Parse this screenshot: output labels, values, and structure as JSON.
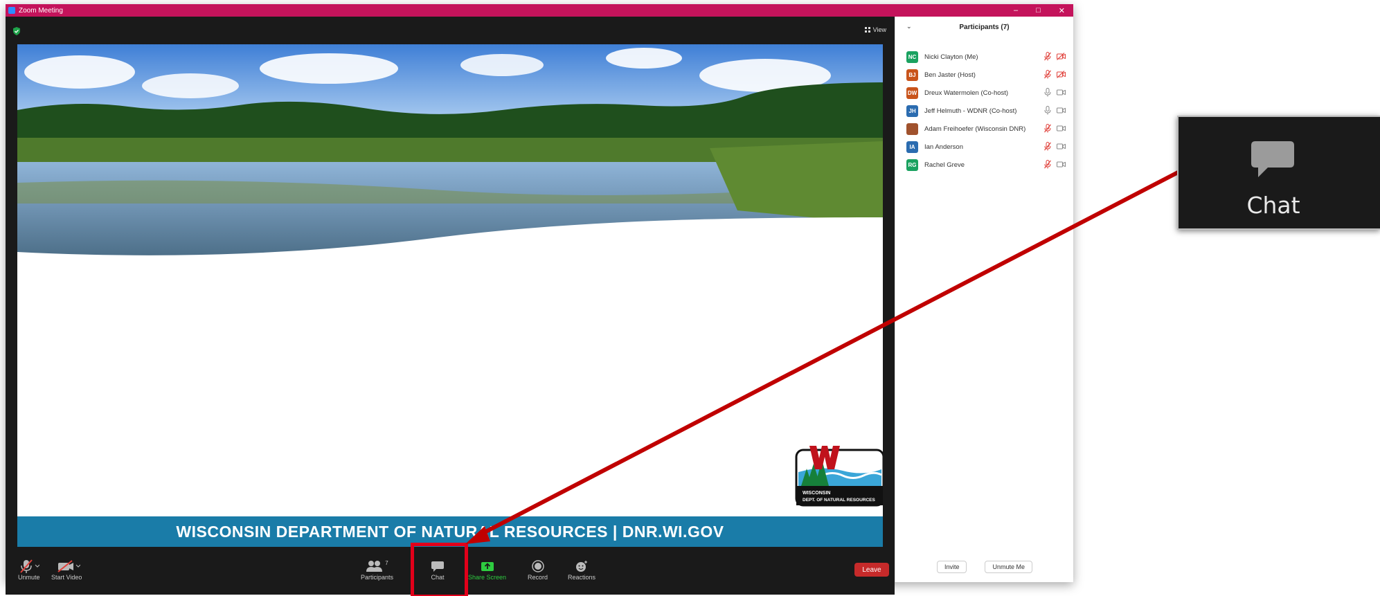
{
  "window": {
    "title": "Zoom Meeting",
    "controls": [
      "–",
      "□",
      "✕"
    ]
  },
  "meeting": {
    "view_label": "View"
  },
  "slide": {
    "banner": "WISCONSIN DEPARTMENT OF NATURAL RESOURCES | DNR.WI.GOV",
    "logo_line1": "WISCONSIN",
    "logo_line2": "DEPT. OF NATURAL RESOURCES"
  },
  "toolbar": {
    "unmute": "Unmute",
    "start_video": "Start Video",
    "participants": "Participants",
    "participants_count": "7",
    "chat": "Chat",
    "share_screen": "Share Screen",
    "record": "Record",
    "reactions": "Reactions",
    "leave": "Leave"
  },
  "panel": {
    "title": "Participants (7)",
    "participants": [
      {
        "initials": "NC",
        "name": "Nicki Clayton (Me)",
        "color": "#1aa260",
        "muted": true,
        "video_off": true
      },
      {
        "initials": "BJ",
        "name": "Ben Jaster (Host)",
        "color": "#c9541b",
        "muted": true,
        "video_off": true
      },
      {
        "initials": "DW",
        "name": "Dreux Watermolen (Co-host)",
        "color": "#c9541b",
        "muted": false,
        "video_off": false
      },
      {
        "initials": "JH",
        "name": "Jeff Helmuth - WDNR (Co-host)",
        "color": "#2b6cb0",
        "muted": false,
        "video_off": false
      },
      {
        "initials": "",
        "name": "Adam Freihoefer (Wisconsin DNR)",
        "color": "#a0522d",
        "muted": true,
        "video_off": false
      },
      {
        "initials": "IA",
        "name": "Ian Anderson",
        "color": "#2b6cb0",
        "muted": true,
        "video_off": false
      },
      {
        "initials": "RG",
        "name": "Rachel Greve",
        "color": "#1aa260",
        "muted": true,
        "video_off": false
      }
    ],
    "invite": "Invite",
    "unmute_me": "Unmute Me"
  },
  "callout": {
    "label": "Chat"
  },
  "colors": {
    "titlebar": "#c4135b",
    "highlight": "#e2001a",
    "banner": "#1a7ca8"
  }
}
